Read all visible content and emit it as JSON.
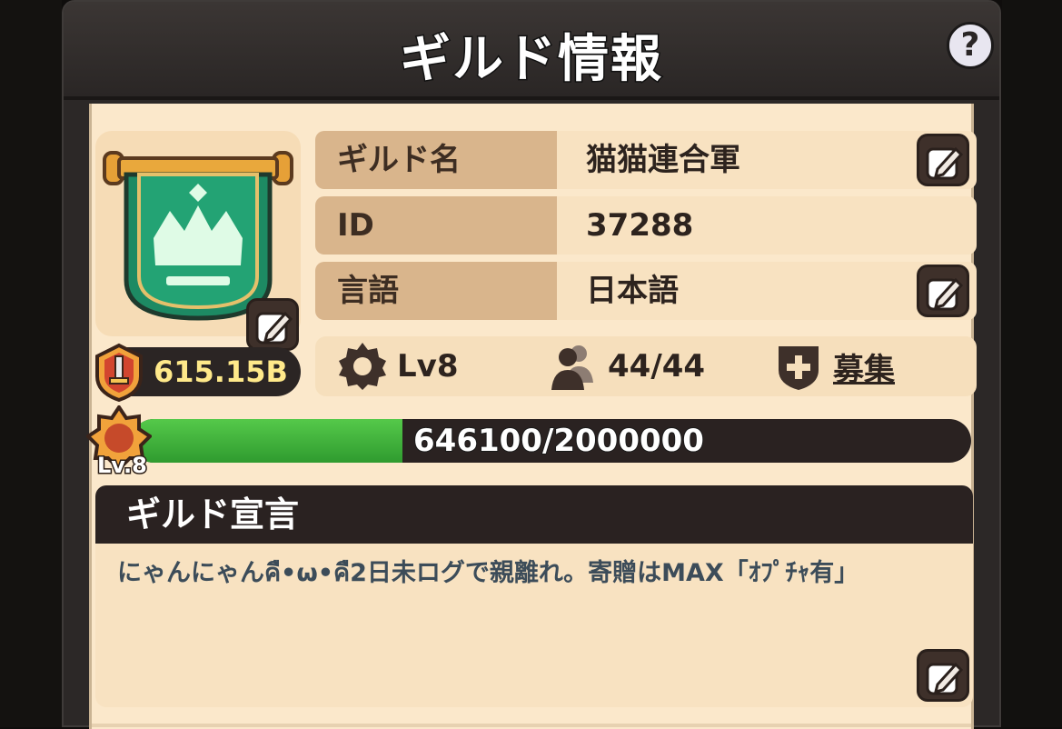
{
  "header": {
    "title": "ギルド情報",
    "help_icon": "question-icon",
    "help_label": "?"
  },
  "guild": {
    "emblem_icon": "crown-banner-icon",
    "rows": [
      {
        "key": "ギルド名",
        "value": "猫猫連合軍",
        "editable": true
      },
      {
        "key": "ID",
        "value": "37288",
        "editable": false
      },
      {
        "key": "言語",
        "value": "日本語",
        "editable": true
      }
    ],
    "power": "615.15B",
    "level_label": "Lv8",
    "members": "44/44",
    "recruit": "募集"
  },
  "xp": {
    "current": 646100,
    "max": 2000000,
    "text": "646100/2000000",
    "badge": "Lv.8"
  },
  "declaration": {
    "title": "ギルド宣言",
    "text": "にゃんにゃんคื•ω•คื2日未ログで親離れ。寄贈はMAX「ｵﾌﾟﾁｬ有」"
  },
  "colors": {
    "accent_green": "#3fb23a",
    "panel_dark": "#2a2221",
    "parchment": "#fbe8cb"
  }
}
